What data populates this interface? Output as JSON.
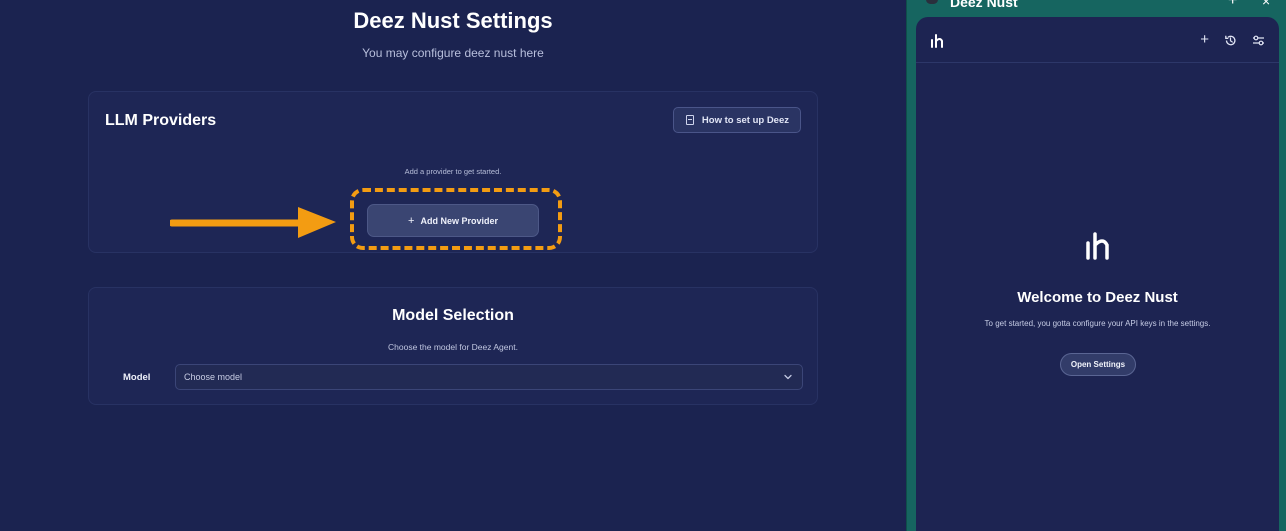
{
  "settings": {
    "title": "Deez Nust Settings",
    "subtitle": "You may configure deez nust here"
  },
  "providers": {
    "title": "LLM Providers",
    "guide_button": "How to set up Deez",
    "hint": "Add a provider to get started.",
    "add_button": "Add New Provider"
  },
  "models": {
    "title": "Model Selection",
    "hint": "Choose the model for Deez Agent.",
    "label": "Model",
    "placeholder": "Choose model"
  },
  "window": {
    "title": "Deez Nust",
    "plus": "+",
    "close": "×"
  },
  "panel": {
    "welcome_title": "Welcome to Deez Nust",
    "welcome_text": "To get started, you gotta configure your API keys in the settings.",
    "open_button": "Open Settings"
  },
  "icons": [
    "book-icon",
    "plus-icon",
    "arrow-right-icon",
    "chevron-down-icon",
    "app-logo-icon",
    "history-icon",
    "settings-sliders-icon",
    "close-icon"
  ],
  "colors": {
    "background": "#1b2350",
    "accent_highlight": "#f39c12",
    "side_frame": "#166560"
  }
}
